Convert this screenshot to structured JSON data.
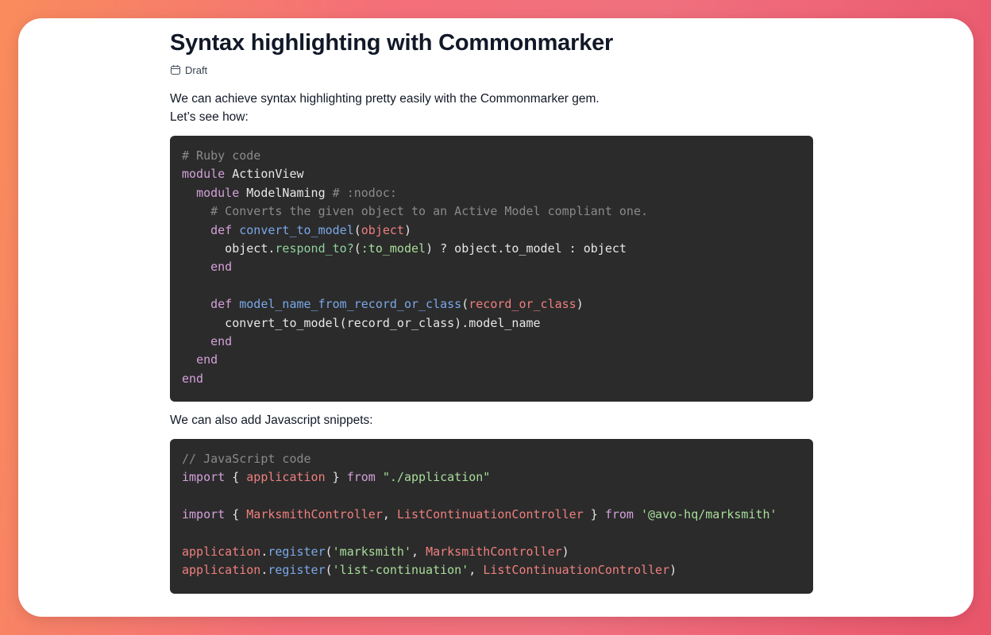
{
  "post": {
    "title": "Syntax highlighting with Commonmarker",
    "status": "Draft",
    "status_icon": "calendar-icon",
    "intro_line1": "We can achieve syntax highlighting pretty easily with the Commonmarker gem.",
    "intro_line2": "Let’s see how:",
    "js_intro": "We can also add Javascript snippets:"
  },
  "ruby_code": [
    [
      [
        "c",
        "# Ruby code"
      ]
    ],
    [
      [
        "k",
        "module"
      ],
      [
        "t",
        " ActionView"
      ]
    ],
    [
      [
        "t",
        "  "
      ],
      [
        "k",
        "module"
      ],
      [
        "t",
        " ModelNaming "
      ],
      [
        "c",
        "# :nodoc:"
      ]
    ],
    [
      [
        "t",
        "    "
      ],
      [
        "c",
        "# Converts the given object to an Active Model compliant one."
      ]
    ],
    [
      [
        "t",
        "    "
      ],
      [
        "k",
        "def"
      ],
      [
        "t",
        " "
      ],
      [
        "f",
        "convert_to_model"
      ],
      [
        "t",
        "("
      ],
      [
        "v",
        "object"
      ],
      [
        "t",
        ")"
      ]
    ],
    [
      [
        "t",
        "      object."
      ],
      [
        "fg",
        "respond_to?"
      ],
      [
        "t",
        "("
      ],
      [
        "s",
        ":to_model"
      ],
      [
        "t",
        ") ? object.to_model : object"
      ]
    ],
    [
      [
        "t",
        "    "
      ],
      [
        "k",
        "end"
      ]
    ],
    [
      [
        "t",
        ""
      ]
    ],
    [
      [
        "t",
        "    "
      ],
      [
        "k",
        "def"
      ],
      [
        "t",
        " "
      ],
      [
        "f",
        "model_name_from_record_or_class"
      ],
      [
        "t",
        "("
      ],
      [
        "v",
        "record_or_class"
      ],
      [
        "t",
        ")"
      ]
    ],
    [
      [
        "t",
        "      convert_to_model(record_or_class).model_name"
      ]
    ],
    [
      [
        "t",
        "    "
      ],
      [
        "k",
        "end"
      ]
    ],
    [
      [
        "t",
        "  "
      ],
      [
        "k",
        "end"
      ]
    ],
    [
      [
        "k",
        "end"
      ]
    ]
  ],
  "js_code": [
    [
      [
        "c",
        "// JavaScript code"
      ]
    ],
    [
      [
        "k",
        "import"
      ],
      [
        "t",
        " { "
      ],
      [
        "v",
        "application"
      ],
      [
        "t",
        " } "
      ],
      [
        "k",
        "from"
      ],
      [
        "t",
        " "
      ],
      [
        "s",
        "\"./application\""
      ]
    ],
    [
      [
        "t",
        ""
      ]
    ],
    [
      [
        "k",
        "import"
      ],
      [
        "t",
        " { "
      ],
      [
        "v",
        "MarksmithController"
      ],
      [
        "t",
        ", "
      ],
      [
        "v",
        "ListContinuationController"
      ],
      [
        "t",
        " } "
      ],
      [
        "k",
        "from"
      ],
      [
        "t",
        " "
      ],
      [
        "s",
        "'@avo-hq/marksmith'"
      ]
    ],
    [
      [
        "t",
        ""
      ]
    ],
    [
      [
        "v",
        "application"
      ],
      [
        "t",
        "."
      ],
      [
        "f",
        "register"
      ],
      [
        "t",
        "("
      ],
      [
        "s",
        "'marksmith'"
      ],
      [
        "t",
        ", "
      ],
      [
        "v",
        "MarksmithController"
      ],
      [
        "t",
        ")"
      ]
    ],
    [
      [
        "v",
        "application"
      ],
      [
        "t",
        "."
      ],
      [
        "f",
        "register"
      ],
      [
        "t",
        "("
      ],
      [
        "s",
        "'list-continuation'"
      ],
      [
        "t",
        ", "
      ],
      [
        "v",
        "ListContinuationController"
      ],
      [
        "t",
        ")"
      ]
    ]
  ]
}
